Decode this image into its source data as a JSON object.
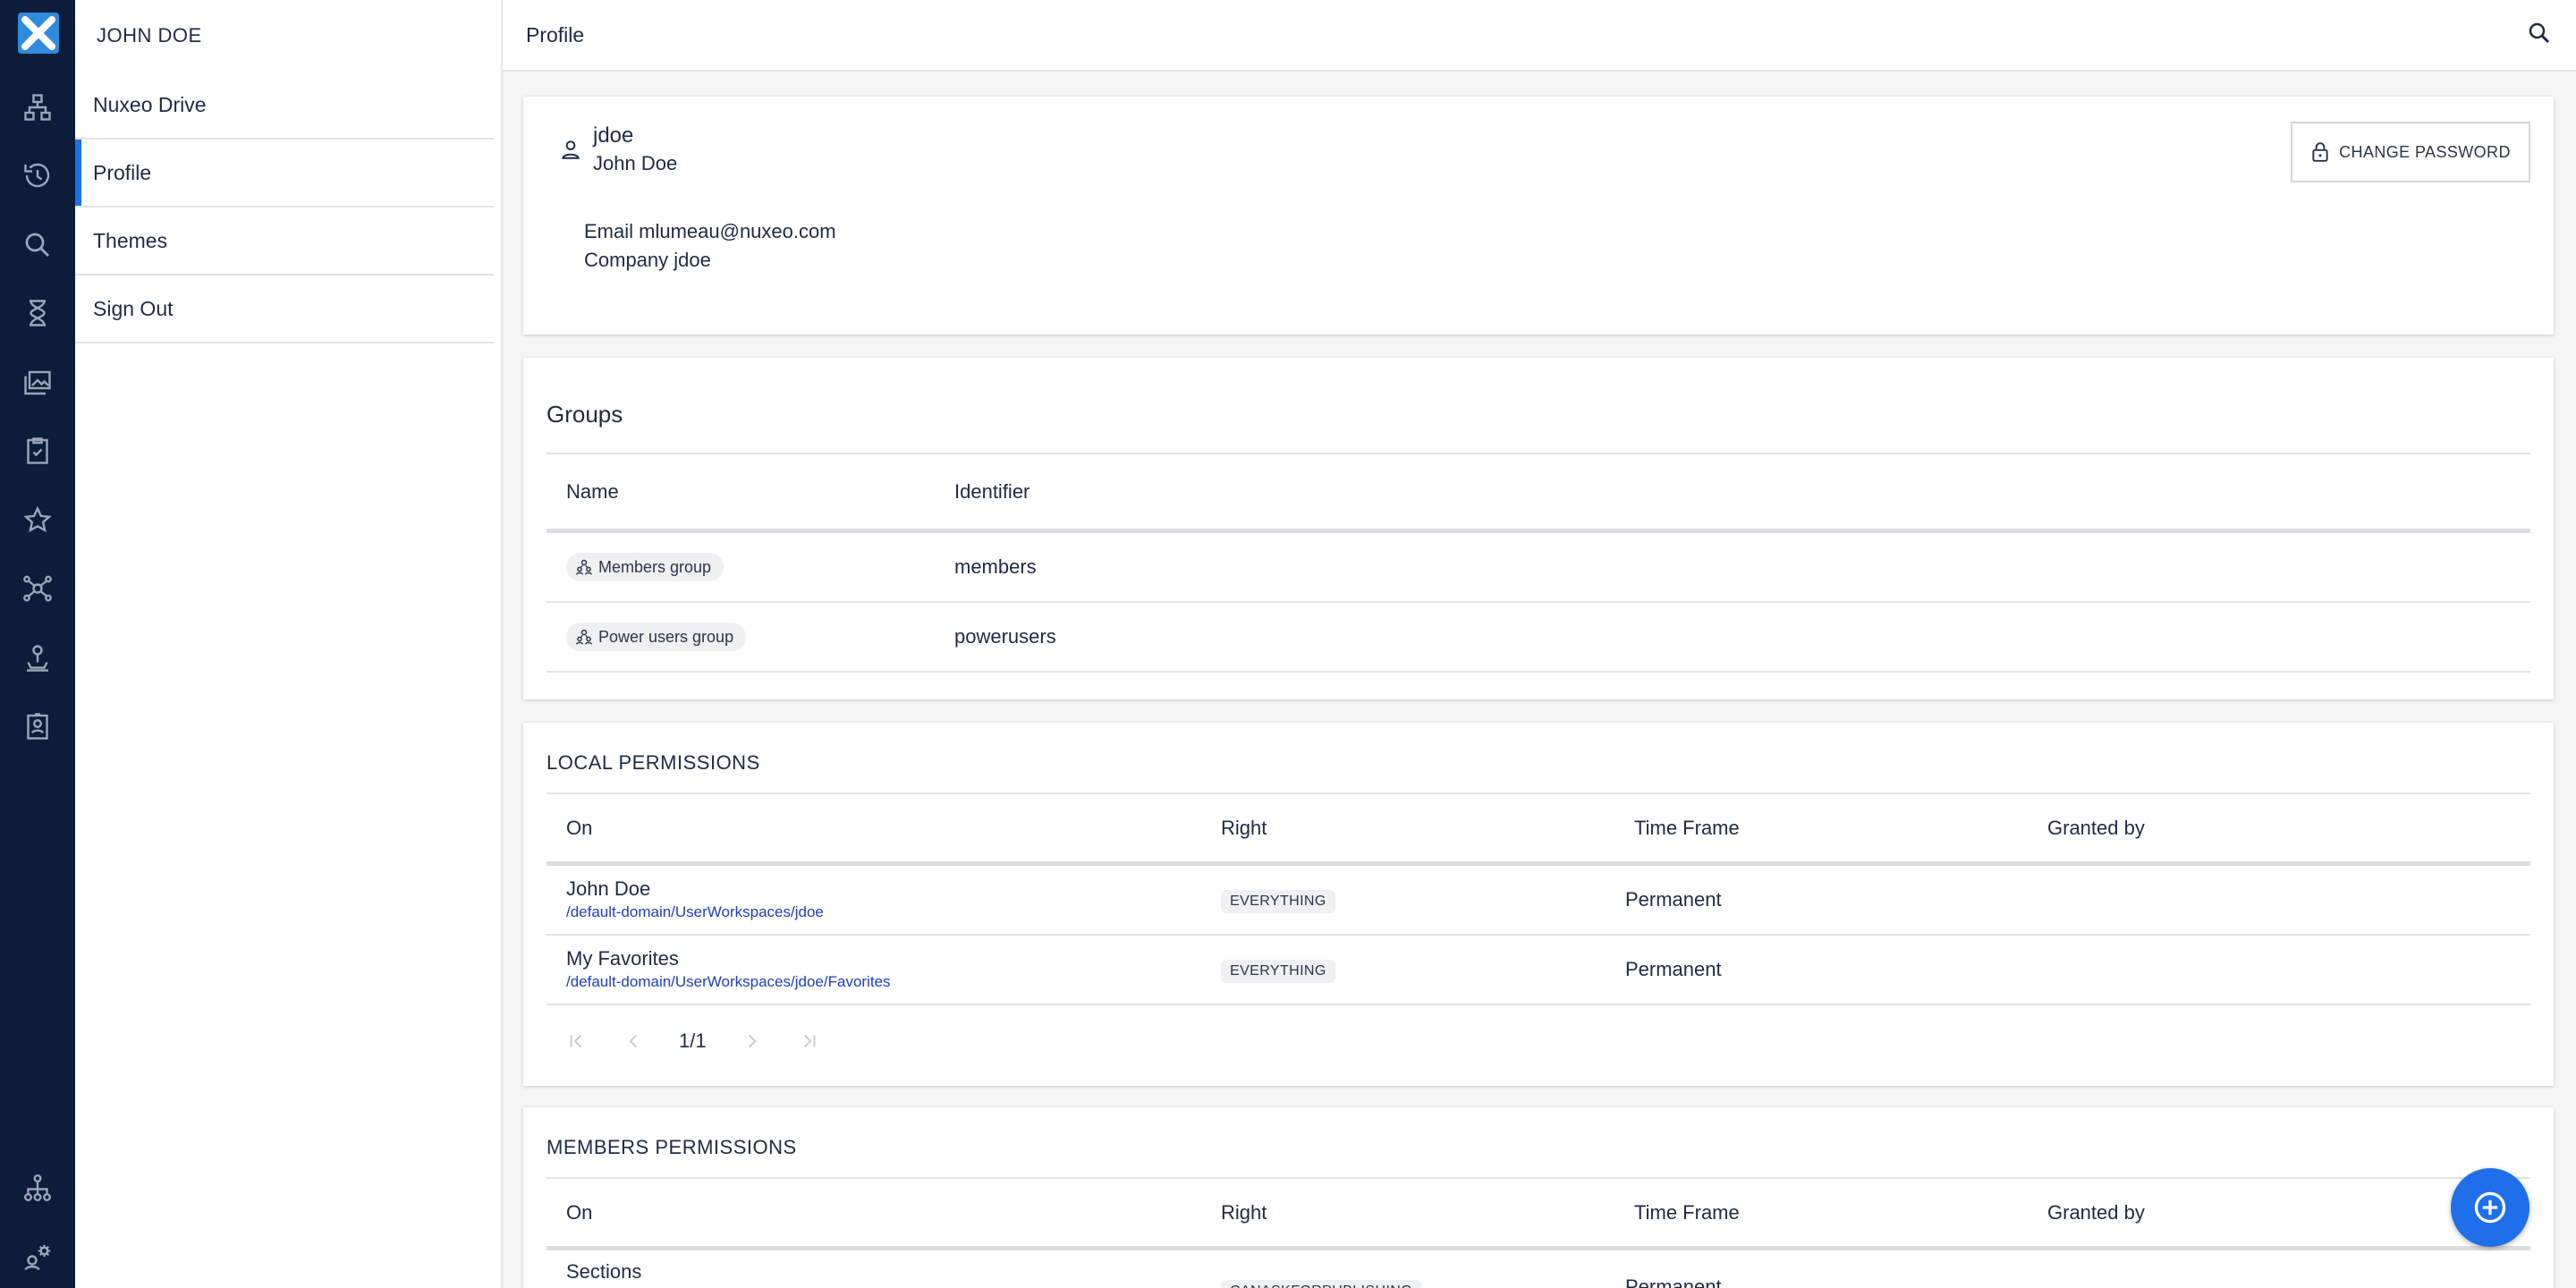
{
  "user": {
    "drawer_name": "JOHN DOE",
    "username": "jdoe",
    "full_name": "John Doe",
    "email_line": "Email mlumeau@nuxeo.com",
    "company_line": "Company jdoe"
  },
  "drawer": {
    "items": [
      {
        "label": "Nuxeo Drive"
      },
      {
        "label": "Profile"
      },
      {
        "label": "Themes"
      },
      {
        "label": "Sign Out"
      }
    ]
  },
  "header": {
    "title": "Profile"
  },
  "profile_card": {
    "change_password_label": "CHANGE PASSWORD"
  },
  "groups": {
    "title": "Groups",
    "columns": [
      "Name",
      "Identifier"
    ],
    "rows": [
      {
        "name": "Members group",
        "identifier": "members"
      },
      {
        "name": "Power users group",
        "identifier": "powerusers"
      }
    ]
  },
  "local_permissions": {
    "title": "LOCAL PERMISSIONS",
    "columns": [
      "On",
      "Right",
      "Time Frame",
      "Granted by"
    ],
    "rows": [
      {
        "title": "John Doe",
        "path": "/default-domain/UserWorkspaces/jdoe",
        "right": "EVERYTHING",
        "time_frame": "Permanent"
      },
      {
        "title": "My Favorites",
        "path": "/default-domain/UserWorkspaces/jdoe/Favorites",
        "right": "EVERYTHING",
        "time_frame": "Permanent"
      }
    ],
    "pagination": "1/1"
  },
  "members_permissions": {
    "title": "MEMBERS PERMISSIONS",
    "columns": [
      "On",
      "Right",
      "Time Frame",
      "Granted by"
    ],
    "rows": [
      {
        "title": "Sections",
        "right": "CANASKFORPUBLISHING",
        "time_frame": "Permanent"
      }
    ]
  },
  "colors": {
    "rail_bg": "#0b1d38",
    "accent": "#1f6feb",
    "logo": "#2f8bdd",
    "link": "#1c3fbf"
  },
  "icons": [
    "nuxeo-logo",
    "browse-icon",
    "history-icon",
    "search-icon",
    "tasks-icon",
    "collections-icon",
    "clipboard-check-icon",
    "favorites-icon",
    "workflow-icon",
    "anchor-icon",
    "profile-badge-icon",
    "network-icon",
    "admin-gear-icon",
    "lock-icon",
    "user-icon",
    "group-icon",
    "add-icon"
  ]
}
